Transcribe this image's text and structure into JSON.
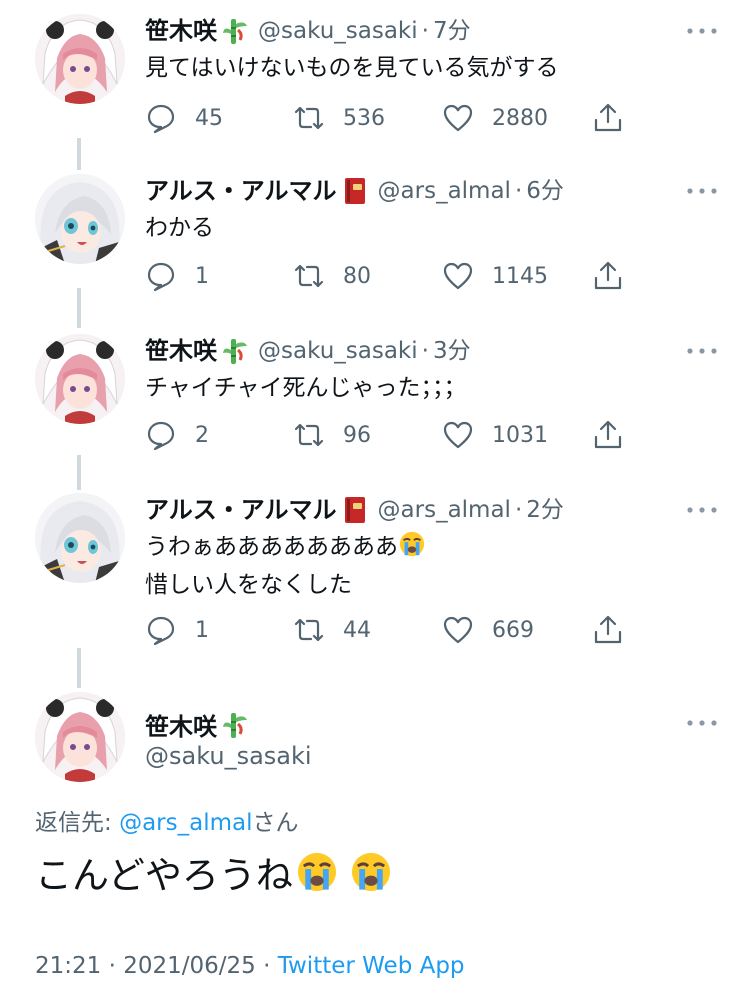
{
  "thread": [
    {
      "name": "笹木咲",
      "badge": "bamboo-icon",
      "handle": "@saku_sasaki",
      "separator": "·",
      "time": "7分",
      "lines": [
        "見てはいけないものを見ている気がする"
      ],
      "replies": "45",
      "retweets": "536",
      "likes": "2880"
    },
    {
      "name": "アルス・アルマル",
      "badge": "red-book-icon",
      "handle": "@ars_almal",
      "separator": "·",
      "time": "6分",
      "lines": [
        "わかる"
      ],
      "replies": "1",
      "retweets": "80",
      "likes": "1145"
    },
    {
      "name": "笹木咲",
      "badge": "bamboo-icon",
      "handle": "@saku_sasaki",
      "separator": "·",
      "time": "3分",
      "lines": [
        "チャイチャイ死んじゃった；；；"
      ],
      "replies": "2",
      "retweets": "96",
      "likes": "1031"
    },
    {
      "name": "アルス・アルマル",
      "badge": "red-book-icon",
      "handle": "@ars_almal",
      "separator": "·",
      "time": "2分",
      "lines": [
        "うわぁああああああああ",
        "惜しい人をなくした"
      ],
      "replies": "1",
      "retweets": "44",
      "likes": "669"
    }
  ],
  "main_tweet": {
    "name": "笹木咲",
    "badge": "bamboo-icon",
    "handle": "@saku_sasaki",
    "reply_prefix": "返信先: ",
    "reply_target": "@ars_almal",
    "reply_suffix": "さん",
    "text": "こんどやろうね",
    "emoji": "loudly-crying-face-icon",
    "time": "21:21",
    "separator": "·",
    "date": "2021/06/25",
    "source": "Twitter Web App"
  },
  "colors": {
    "text": "#0f1419",
    "secondary": "#536471",
    "link": "#1d9bf0",
    "thread_line": "#cfd9de"
  }
}
